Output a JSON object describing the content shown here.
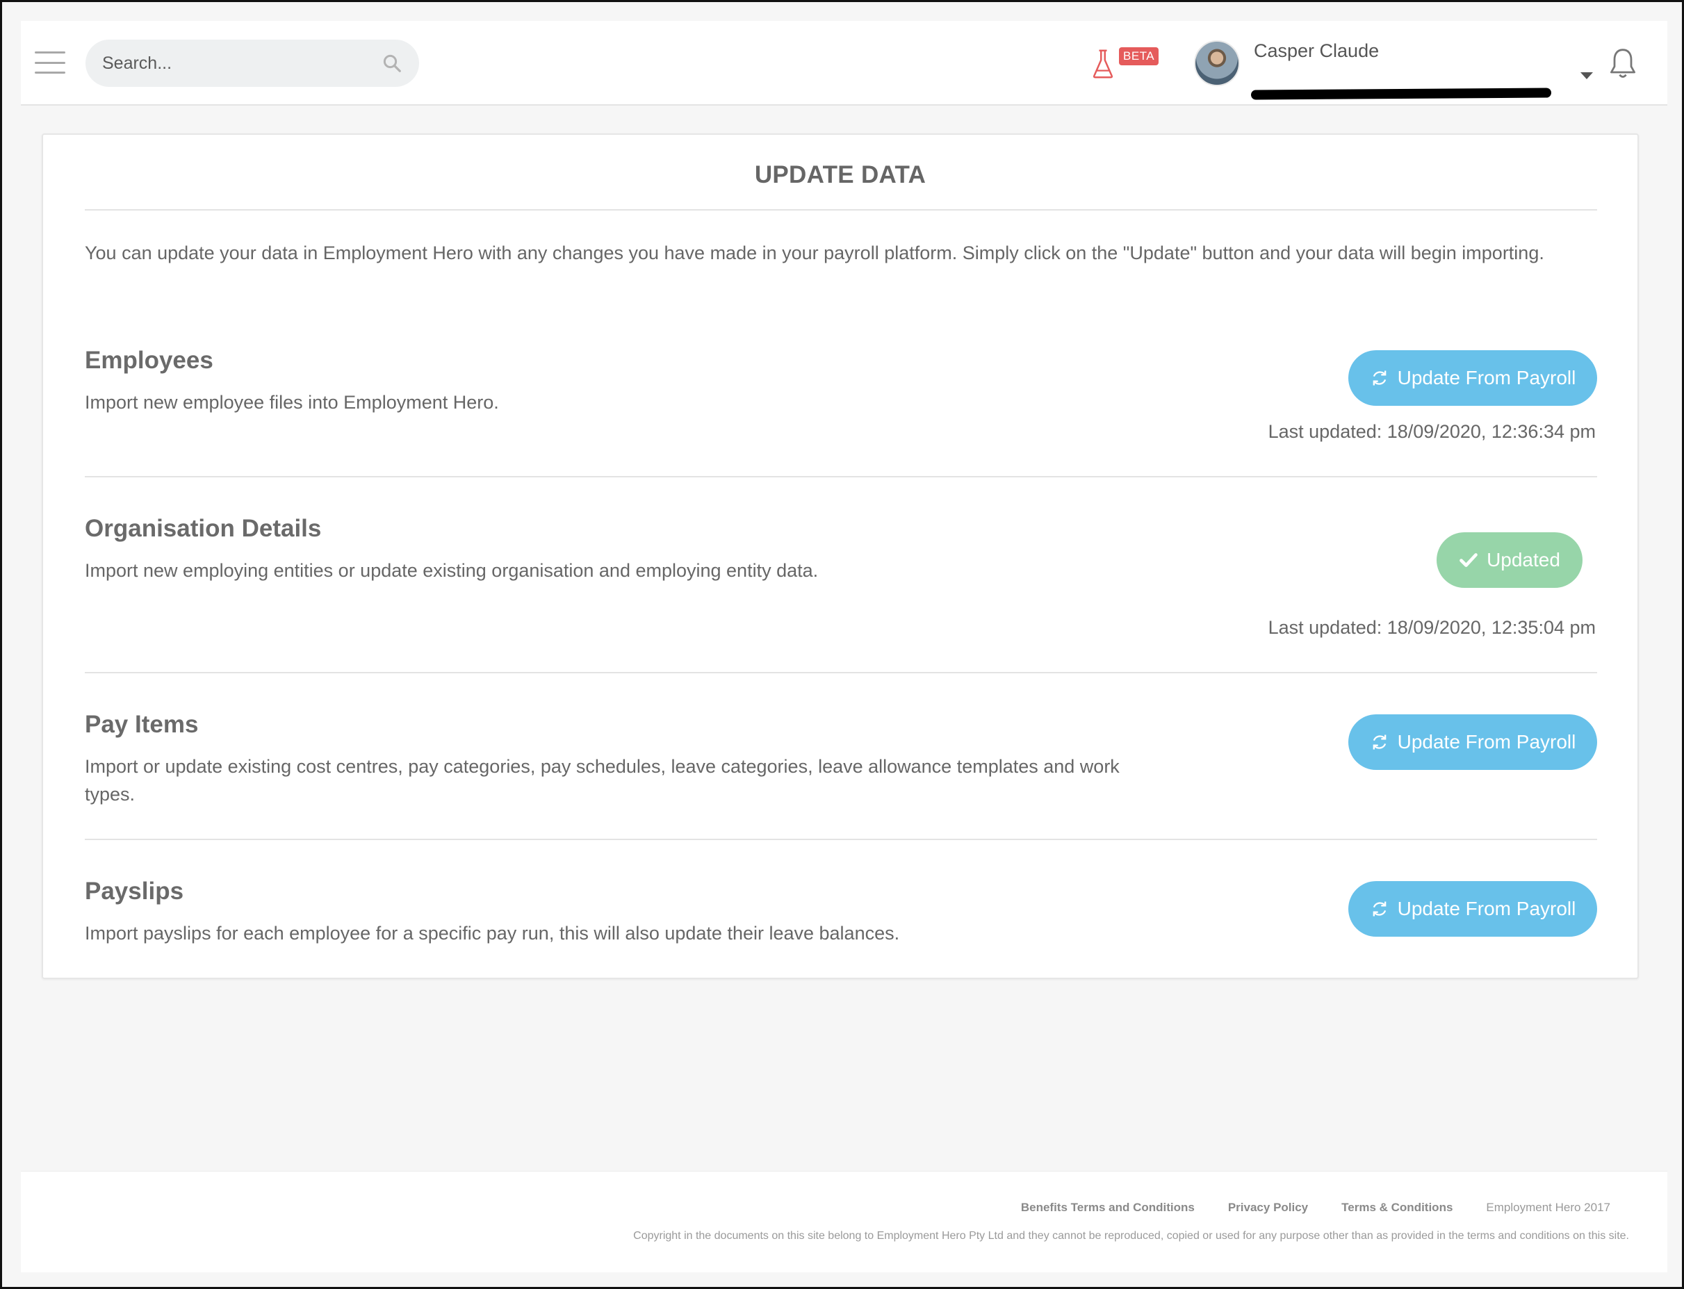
{
  "header": {
    "search_placeholder": "Search...",
    "beta_label": "BETA",
    "user_name": "Casper Claude"
  },
  "page": {
    "title": "UPDATE DATA",
    "intro": "You can update your data in Employment Hero with any changes you have made in your payroll platform. Simply click on the \"Update\" button and your data will begin importing."
  },
  "sections": [
    {
      "title": "Employees",
      "description": "Import new employee files into Employment Hero.",
      "button": "Update From Payroll",
      "last_updated": "Last updated: 18/09/2020, 12:36:34 pm"
    },
    {
      "title": "Organisation Details",
      "description": "Import new employing entities or update existing organisation and employing entity data.",
      "button": "Updated",
      "last_updated": "Last updated: 18/09/2020, 12:35:04 pm"
    },
    {
      "title": "Pay Items",
      "description": "Import or update existing cost centres, pay categories, pay schedules, leave categories, leave allowance templates and work types.",
      "button": "Update From Payroll"
    },
    {
      "title": "Payslips",
      "description": "Import payslips for each employee for a specific pay run, this will also update their leave balances.",
      "button": "Update From Payroll"
    }
  ],
  "footer": {
    "links": [
      "Benefits Terms and Conditions",
      "Privacy Policy",
      "Terms & Conditions"
    ],
    "brand": "Employment Hero 2017",
    "copyright": "Copyright in the documents on this site belong to Employment Hero Pty Ltd and they cannot be reproduced, copied or used for any purpose other than as provided in the terms and conditions on this site."
  },
  "colors": {
    "primary_button": "#68c1ea",
    "success_button": "#97d5a9",
    "beta_badge": "#e55b5b"
  },
  "icons": [
    "menu-icon",
    "search-icon",
    "flask-icon",
    "caret-down-icon",
    "bell-icon",
    "refresh-icon",
    "check-icon"
  ]
}
